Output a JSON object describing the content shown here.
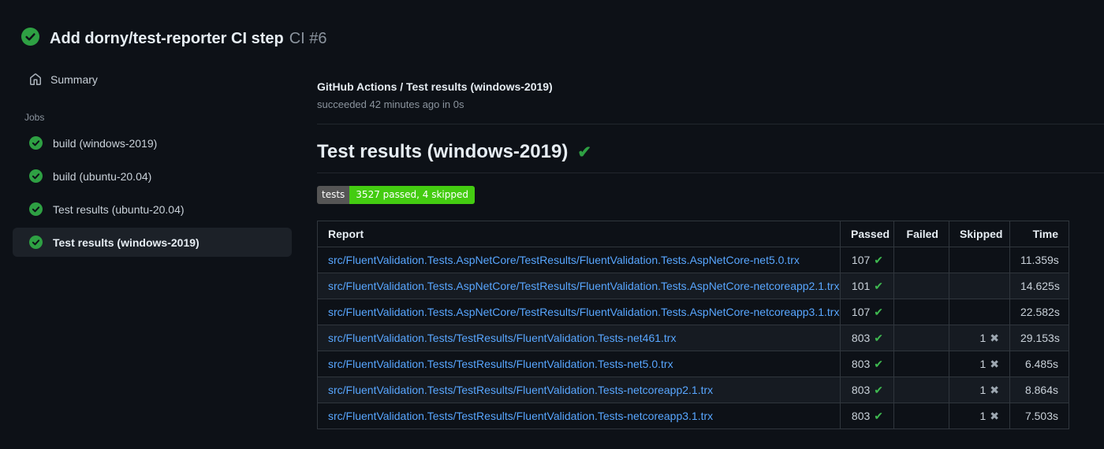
{
  "page": {
    "title": "Add dorny/test-reporter CI step",
    "run_number": "CI #6"
  },
  "colors": {
    "background": "#0d1117",
    "success_green": "#2ea043",
    "check_green": "#3fb950",
    "link_blue": "#58a6ff",
    "badge_gray": "#555555",
    "badge_green": "#44cc11",
    "selected_item_bg": "#1c2128",
    "border": "#30363d"
  },
  "icons": {
    "header_status": "check-circle-icon",
    "summary": "home-icon",
    "job_status": "check-circle-icon",
    "passed_mark": "✔",
    "skipped_mark": "✖",
    "title_mark": "✔"
  },
  "sidebar": {
    "summary_label": "Summary",
    "jobs_label": "Jobs",
    "jobs": [
      {
        "label": "build (windows-2019)",
        "selected": false
      },
      {
        "label": "build (ubuntu-20.04)",
        "selected": false
      },
      {
        "label": "Test results (ubuntu-20.04)",
        "selected": false
      },
      {
        "label": "Test results (windows-2019)",
        "selected": true
      }
    ]
  },
  "main": {
    "breadcrumb": "GitHub Actions / Test results (windows-2019)",
    "status_line": "succeeded 42 minutes ago in 0s",
    "section_title": "Test results (windows-2019)",
    "badge": {
      "label": "tests",
      "value": "3527 passed, 4 skipped"
    },
    "table": {
      "headers": [
        "Report",
        "Passed",
        "Failed",
        "Skipped",
        "Time"
      ],
      "rows": [
        {
          "report": "src/FluentValidation.Tests.AspNetCore/TestResults/FluentValidation.Tests.AspNetCore-net5.0.trx",
          "passed": "107",
          "failed": "",
          "skipped": "",
          "time": "11.359s"
        },
        {
          "report": "src/FluentValidation.Tests.AspNetCore/TestResults/FluentValidation.Tests.AspNetCore-netcoreapp2.1.trx",
          "passed": "101",
          "failed": "",
          "skipped": "",
          "time": "14.625s"
        },
        {
          "report": "src/FluentValidation.Tests.AspNetCore/TestResults/FluentValidation.Tests.AspNetCore-netcoreapp3.1.trx",
          "passed": "107",
          "failed": "",
          "skipped": "",
          "time": "22.582s"
        },
        {
          "report": "src/FluentValidation.Tests/TestResults/FluentValidation.Tests-net461.trx",
          "passed": "803",
          "failed": "",
          "skipped": "1",
          "time": "29.153s"
        },
        {
          "report": "src/FluentValidation.Tests/TestResults/FluentValidation.Tests-net5.0.trx",
          "passed": "803",
          "failed": "",
          "skipped": "1",
          "time": "6.485s"
        },
        {
          "report": "src/FluentValidation.Tests/TestResults/FluentValidation.Tests-netcoreapp2.1.trx",
          "passed": "803",
          "failed": "",
          "skipped": "1",
          "time": "8.864s"
        },
        {
          "report": "src/FluentValidation.Tests/TestResults/FluentValidation.Tests-netcoreapp3.1.trx",
          "passed": "803",
          "failed": "",
          "skipped": "1",
          "time": "7.503s"
        }
      ]
    }
  }
}
